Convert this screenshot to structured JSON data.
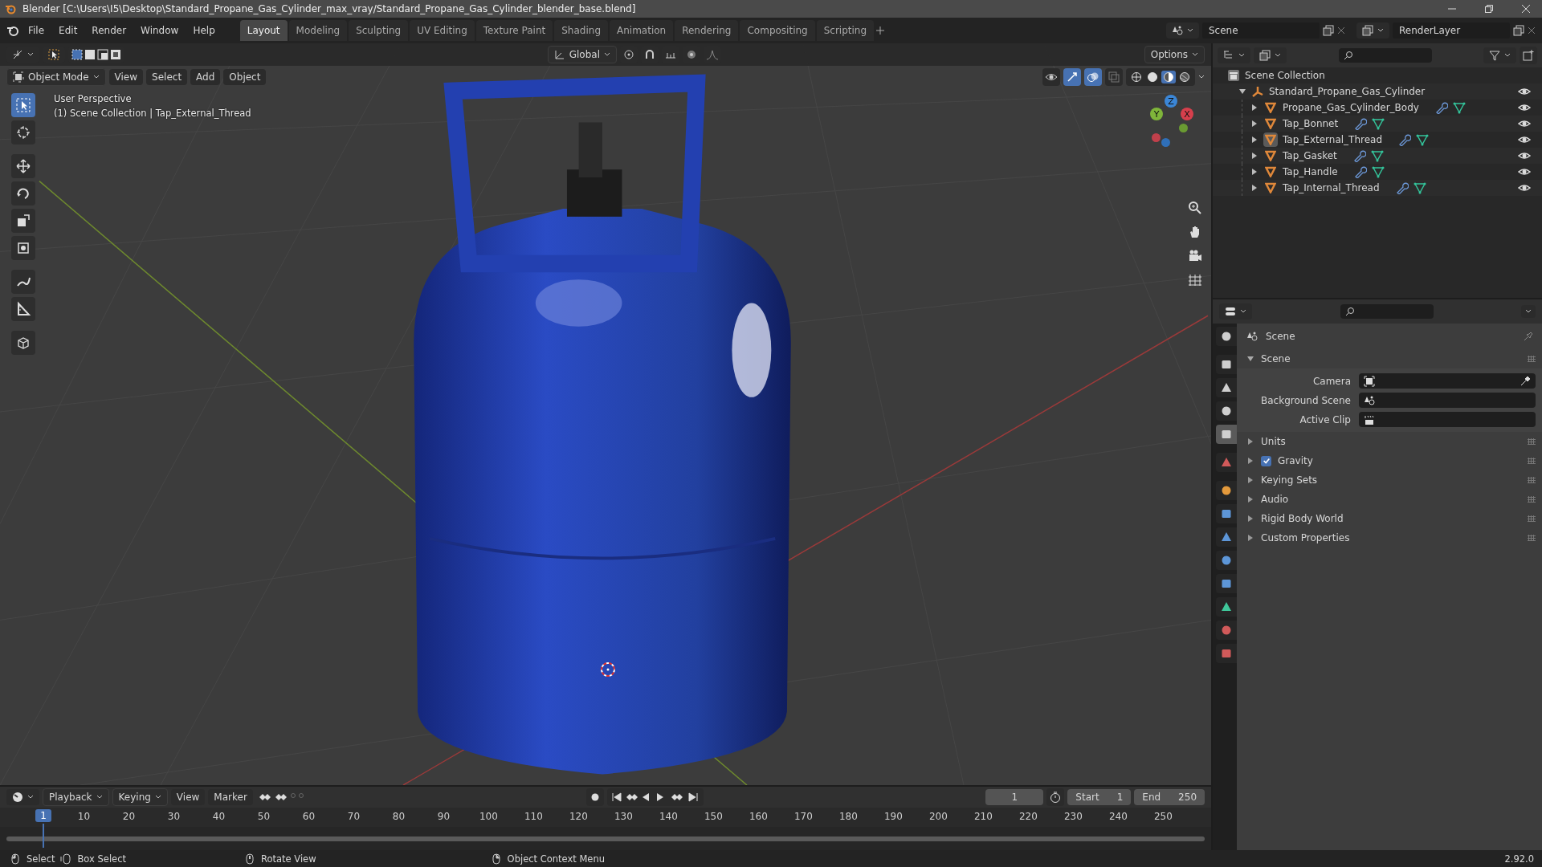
{
  "window": {
    "title": "Blender [C:\\Users\\I5\\Desktop\\Standard_Propane_Gas_Cylinder_max_vray/Standard_Propane_Gas_Cylinder_blender_base.blend]"
  },
  "menu": [
    "File",
    "Edit",
    "Render",
    "Window",
    "Help"
  ],
  "workspaces": [
    {
      "label": "Layout",
      "selected": true
    },
    {
      "label": "Modeling",
      "selected": false
    },
    {
      "label": "Sculpting",
      "selected": false
    },
    {
      "label": "UV Editing",
      "selected": false
    },
    {
      "label": "Texture Paint",
      "selected": false
    },
    {
      "label": "Shading",
      "selected": false
    },
    {
      "label": "Animation",
      "selected": false
    },
    {
      "label": "Rendering",
      "selected": false
    },
    {
      "label": "Compositing",
      "selected": false
    },
    {
      "label": "Scripting",
      "selected": false
    }
  ],
  "scene": "Scene",
  "view_layer": "RenderLayer",
  "viewport": {
    "transform_orientation": "Global",
    "options": "Options",
    "mode": "Object Mode",
    "menus": [
      "View",
      "Select",
      "Add",
      "Object"
    ],
    "info": [
      "User Perspective",
      "(1) Scene Collection | Tap_External_Thread"
    ],
    "shading": [
      {
        "selected": false
      },
      {
        "selected": false
      },
      {
        "selected": true
      },
      {
        "selected": false
      }
    ],
    "tools": [
      {
        "kind": "select",
        "selected": true
      },
      {
        "kind": "cursor",
        "selected": false
      },
      {
        "kind": "move",
        "selected": false
      },
      {
        "kind": "rotate",
        "selected": false
      },
      {
        "kind": "scale",
        "selected": false
      },
      {
        "kind": "transform",
        "selected": false
      },
      {
        "kind": "annotate",
        "selected": false
      },
      {
        "kind": "measure",
        "selected": false
      },
      {
        "kind": "add-cube",
        "selected": false
      }
    ],
    "gizmo": [
      {
        "label": "Z",
        "color": "#3b86d6"
      },
      {
        "label": "Y",
        "color": "#7fb53a"
      },
      {
        "label": "X",
        "color": "#d63f4c"
      }
    ]
  },
  "outliner": {
    "root": "Scene Collection",
    "collection": {
      "name": "Standard_Propane_Gas_Cylinder",
      "expanded": true,
      "children": [
        {
          "name": "Propane_Gas_Cylinder_Body",
          "selected": false
        },
        {
          "name": "Tap_Bonnet",
          "selected": false
        },
        {
          "name": "Tap_External_Thread",
          "selected": true
        },
        {
          "name": "Tap_Gasket",
          "selected": false
        },
        {
          "name": "Tap_Handle",
          "selected": false
        },
        {
          "name": "Tap_Internal_Thread",
          "selected": false
        }
      ]
    }
  },
  "properties": {
    "tabs": [
      {
        "kind": "tool",
        "selected": false
      },
      {
        "kind": "render",
        "selected": false
      },
      {
        "kind": "output",
        "selected": false
      },
      {
        "kind": "view-layer",
        "selected": false
      },
      {
        "kind": "scene",
        "selected": true
      },
      {
        "kind": "world",
        "selected": false
      },
      {
        "kind": "object",
        "selected": false
      },
      {
        "kind": "modifier",
        "selected": false
      },
      {
        "kind": "particles",
        "selected": false
      },
      {
        "kind": "physics",
        "selected": false
      },
      {
        "kind": "constraints",
        "selected": false
      },
      {
        "kind": "data",
        "selected": false
      },
      {
        "kind": "material",
        "selected": false
      },
      {
        "kind": "texture",
        "selected": false
      }
    ],
    "header": "Scene",
    "panel": {
      "label": "Scene",
      "expanded": true,
      "fields": [
        {
          "label": "Camera",
          "kind": "camera"
        },
        {
          "label": "Background Scene",
          "kind": "scene"
        },
        {
          "label": "Active Clip",
          "kind": "clip"
        }
      ]
    },
    "sections": [
      {
        "label": "Units",
        "kind": "plain"
      },
      {
        "label": "Gravity",
        "kind": "checkbox",
        "checked": true
      },
      {
        "label": "Keying Sets",
        "kind": "plain"
      },
      {
        "label": "Audio",
        "kind": "plain"
      },
      {
        "label": "Rigid Body World",
        "kind": "plain"
      },
      {
        "label": "Custom Properties",
        "kind": "plain"
      }
    ]
  },
  "timeline": {
    "menus": [
      "Playback",
      "Keying"
    ],
    "items": [
      "View",
      "Marker"
    ],
    "current_frame": "1",
    "start_label": "Start",
    "start": "1",
    "end_label": "End",
    "end": "250",
    "playhead": "1",
    "ticks": [
      "10",
      "20",
      "30",
      "40",
      "50",
      "60",
      "70",
      "80",
      "90",
      "100",
      "110",
      "120",
      "130",
      "140",
      "150",
      "160",
      "170",
      "180",
      "190",
      "200",
      "210",
      "220",
      "230",
      "240",
      "250"
    ]
  },
  "status_bar": {
    "items": [
      "Select",
      "Box Select",
      "Rotate View",
      "Object Context Menu"
    ],
    "version": "2.92.0"
  }
}
